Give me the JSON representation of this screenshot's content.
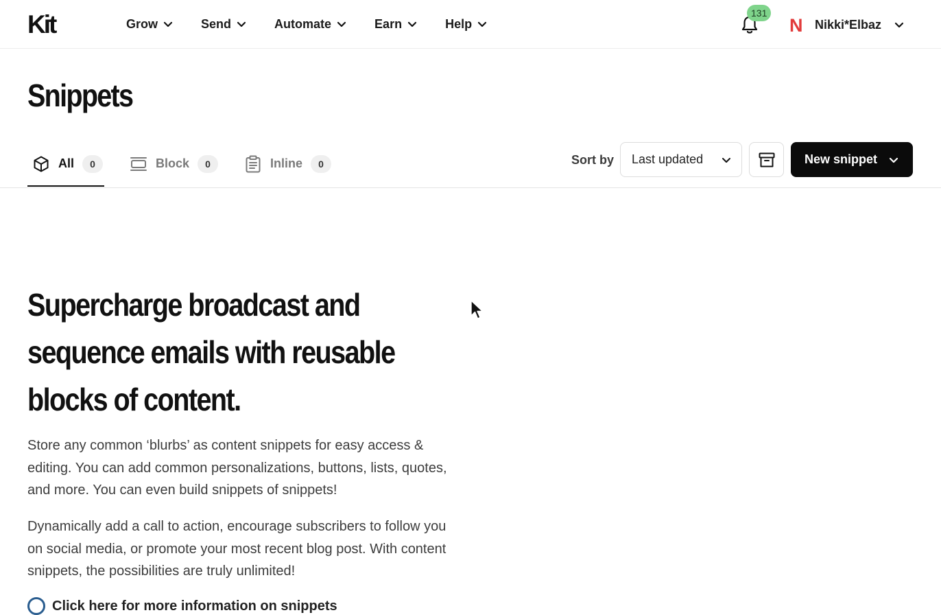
{
  "brand": {
    "logo_text": "Kit"
  },
  "nav": {
    "items": [
      {
        "label": "Grow"
      },
      {
        "label": "Send"
      },
      {
        "label": "Automate"
      },
      {
        "label": "Earn"
      },
      {
        "label": "Help"
      }
    ],
    "notifications_count": "131",
    "account_initial": "N",
    "account_name": "Nikki*Elbaz"
  },
  "page": {
    "title": "Snippets"
  },
  "tabs": [
    {
      "label": "All",
      "count": "0",
      "icon": "cube-icon",
      "active": true
    },
    {
      "label": "Block",
      "count": "0",
      "icon": "block-icon",
      "active": false
    },
    {
      "label": "Inline",
      "count": "0",
      "icon": "clipboard-icon",
      "active": false
    }
  ],
  "toolbar": {
    "sort_label": "Sort by",
    "sort_value": "Last updated",
    "archive_icon": "archive-icon",
    "new_label": "New snippet"
  },
  "hero": {
    "heading": "Supercharge broadcast and sequence emails with reusable blocks of content.",
    "paragraph1": "Store any common ‘blurbs’ as content snippets for easy access & editing. You can add common personalizations, buttons, lists, quotes, and more. You can even build snippets of snippets!",
    "paragraph2": "Dynamically add a call to action, encourage subscribers to follow you on social media, or promote your most recent blog post. With content snippets, the possibilities are truly unlimited!",
    "partial_link": "Click here for more information on snippets"
  },
  "colors": {
    "primary_button": "#0b0b0b",
    "badge": "#7fd48b",
    "avatar": "#e23b3b",
    "link_circle": "#2a5d8f"
  }
}
